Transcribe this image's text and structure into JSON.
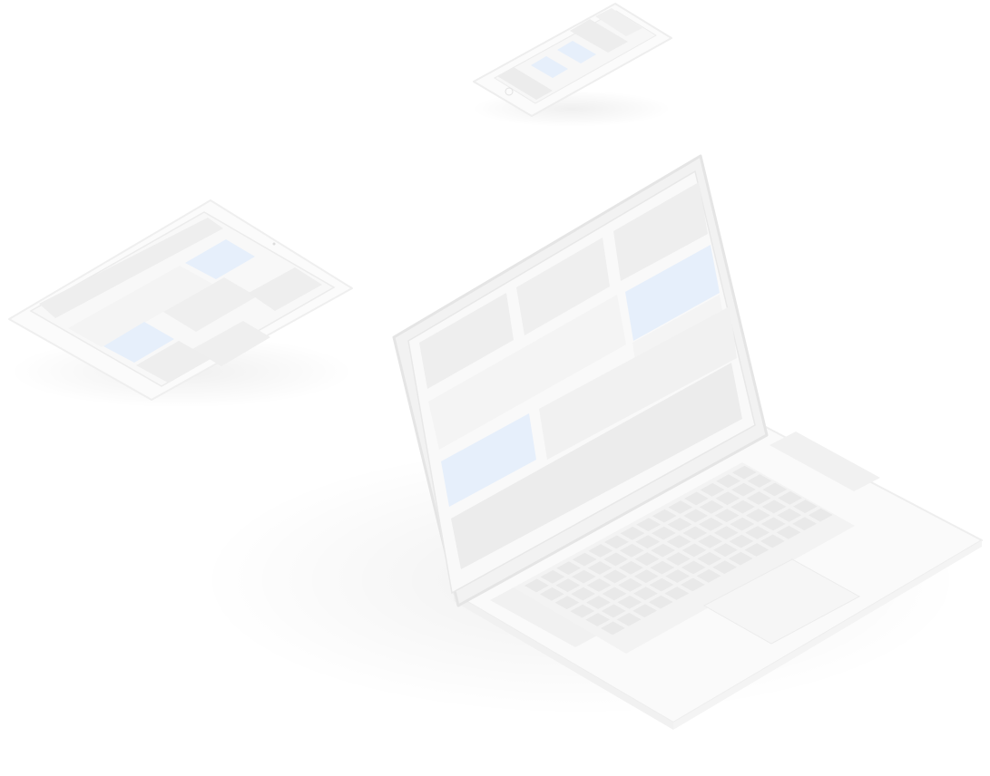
{
  "scene": {
    "description_visible_text": "",
    "devices": [
      {
        "kind": "tablet",
        "highlight_blocks": 2
      },
      {
        "kind": "phone",
        "highlight_blocks": 2
      },
      {
        "kind": "laptop",
        "highlight_blocks": 2
      }
    ]
  },
  "colors": {
    "background": "#ffffff",
    "device_body": "#fbfbfb",
    "device_edge": "#eeeeee",
    "screen_bezel": "#e4e4e4",
    "placeholder_block": "#eeeeee",
    "placeholder_light": "#f4f4f4",
    "highlight_block": "#e6effb",
    "keyboard_key": "#e9e9e9",
    "trackpad": "#f7f7f7"
  }
}
